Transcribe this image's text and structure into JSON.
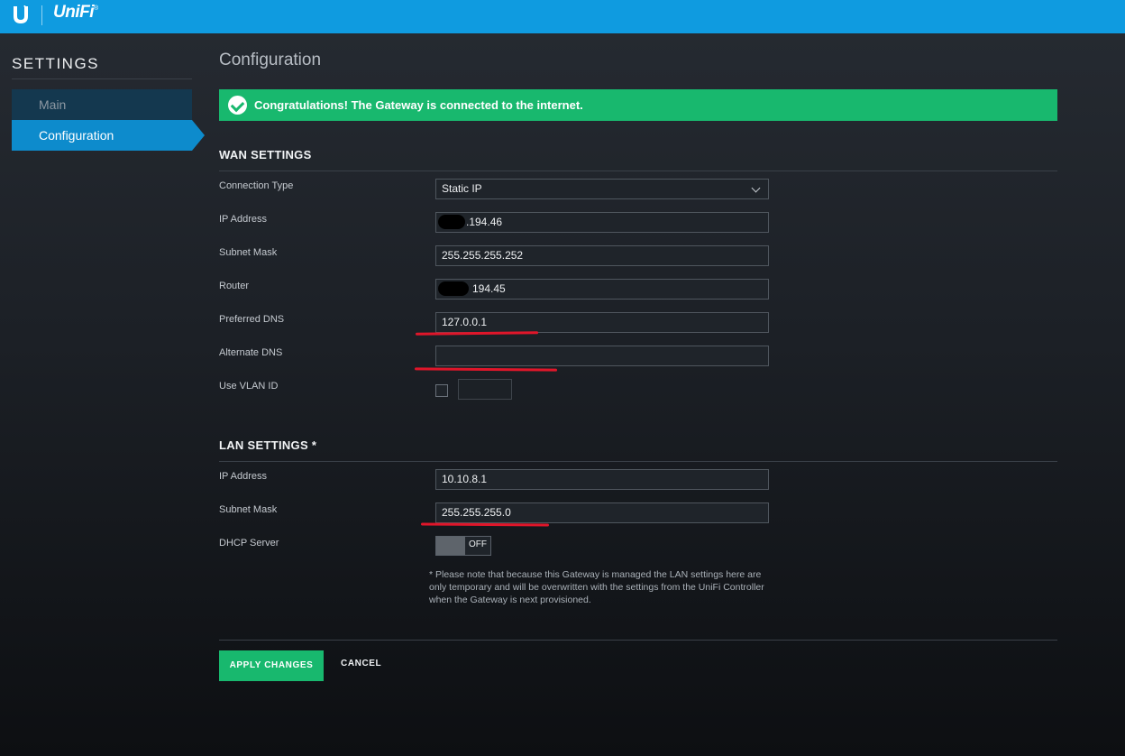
{
  "header": {
    "brand": "UniFi",
    "brand_mark": "®",
    "logo_icon": "ubiquiti-u-icon"
  },
  "sidebar": {
    "title": "SETTINGS",
    "items": [
      {
        "label": "Main",
        "active": false
      },
      {
        "label": "Configuration",
        "active": true
      }
    ]
  },
  "main": {
    "title": "Configuration",
    "alert": {
      "text": "Congratulations! The Gateway is connected to the internet.",
      "icon": "check-circle-icon",
      "color": "#18b86e"
    },
    "wan": {
      "title": "WAN SETTINGS",
      "connection_type": {
        "label": "Connection Type",
        "value": "Static IP"
      },
      "ip_address": {
        "label": "IP Address",
        "value": ".194.46"
      },
      "subnet_mask": {
        "label": "Subnet Mask",
        "value": "255.255.255.252"
      },
      "router": {
        "label": "Router",
        "value": "194.45"
      },
      "preferred_dns": {
        "label": "Preferred DNS",
        "value": "127.0.0.1"
      },
      "alternate_dns": {
        "label": "Alternate DNS",
        "value": ""
      },
      "use_vlan_id": {
        "label": "Use VLAN ID",
        "checked": false,
        "value": ""
      }
    },
    "lan": {
      "title": "LAN SETTINGS *",
      "ip_address": {
        "label": "IP Address",
        "value": "10.10.8.1"
      },
      "subnet_mask": {
        "label": "Subnet Mask",
        "value": "255.255.255.0"
      },
      "dhcp_server": {
        "label": "DHCP Server",
        "state": "OFF"
      },
      "note": "* Please note that because this Gateway is managed the LAN settings here are only temporary and will be overwritten with the settings from the UniFi Controller when the Gateway is next provisioned."
    },
    "actions": {
      "apply": "APPLY CHANGES",
      "cancel": "CANCEL"
    }
  },
  "colors": {
    "topbar": "#0f9be0",
    "accent": "#0d8bcc",
    "success": "#18b86e",
    "annotation": "#e0162a"
  }
}
